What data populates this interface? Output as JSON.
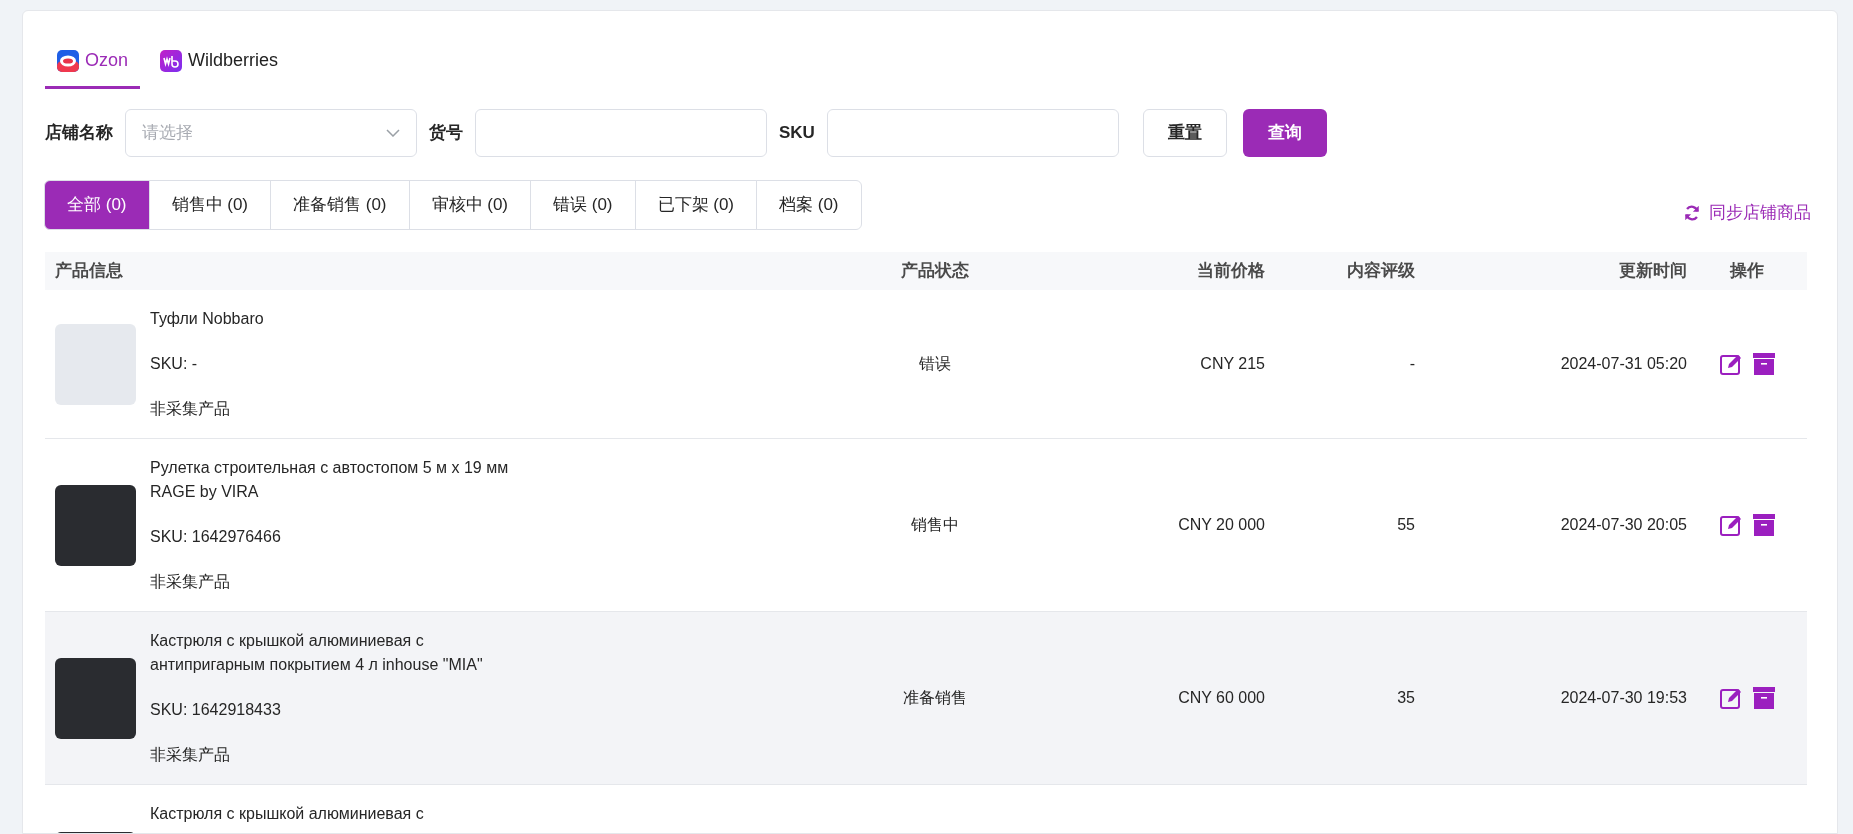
{
  "platform_tabs": [
    {
      "label": "Ozon",
      "kind": "ozon",
      "selected": true
    },
    {
      "label": "Wildberries",
      "kind": "wb",
      "selected": false
    }
  ],
  "filters": {
    "shop_label": "店铺名称",
    "shop_placeholder": "请选择",
    "article_label": "货号",
    "sku_label": "SKU",
    "reset_button": "重置",
    "search_button": "查询"
  },
  "status_tabs": [
    {
      "label": "全部 (0)",
      "selected": true
    },
    {
      "label": "销售中 (0)",
      "selected": false
    },
    {
      "label": "准备销售 (0)",
      "selected": false
    },
    {
      "label": "审核中 (0)",
      "selected": false
    },
    {
      "label": "错误 (0)",
      "selected": false
    },
    {
      "label": "已下架 (0)",
      "selected": false
    },
    {
      "label": "档案 (0)",
      "selected": false
    }
  ],
  "sync_link": "同步店铺商品",
  "table": {
    "columns": [
      "产品信息",
      "产品状态",
      "当前价格",
      "内容评级",
      "更新时间",
      "操作"
    ],
    "rows": [
      {
        "title": "Туфли Nobbaro",
        "sku": "SKU: -",
        "source": "非采集产品",
        "status": "错误",
        "price": "CNY 215",
        "rating": "-",
        "updated": "2024-07-31 05:20",
        "hovered": false
      },
      {
        "title": "Рулетка строительная с автостопом 5 м х 19 мм RAGE by VIRA",
        "sku": "SKU: 1642976466",
        "source": "非采集产品",
        "status": "销售中",
        "price": "CNY 20 000",
        "rating": "55",
        "updated": "2024-07-30 20:05",
        "hovered": false
      },
      {
        "title": "Кастрюля с крышкой алюминиевая с антипригарным покрытием 4 л inhouse \"MIA\"",
        "sku": "SKU: 1642918433",
        "source": "非采集产品",
        "status": "准备销售",
        "price": "CNY 60 000",
        "rating": "35",
        "updated": "2024-07-30 19:53",
        "hovered": true
      },
      {
        "title": "Кастрюля с крышкой алюминиевая с",
        "hovered": false
      }
    ]
  }
}
